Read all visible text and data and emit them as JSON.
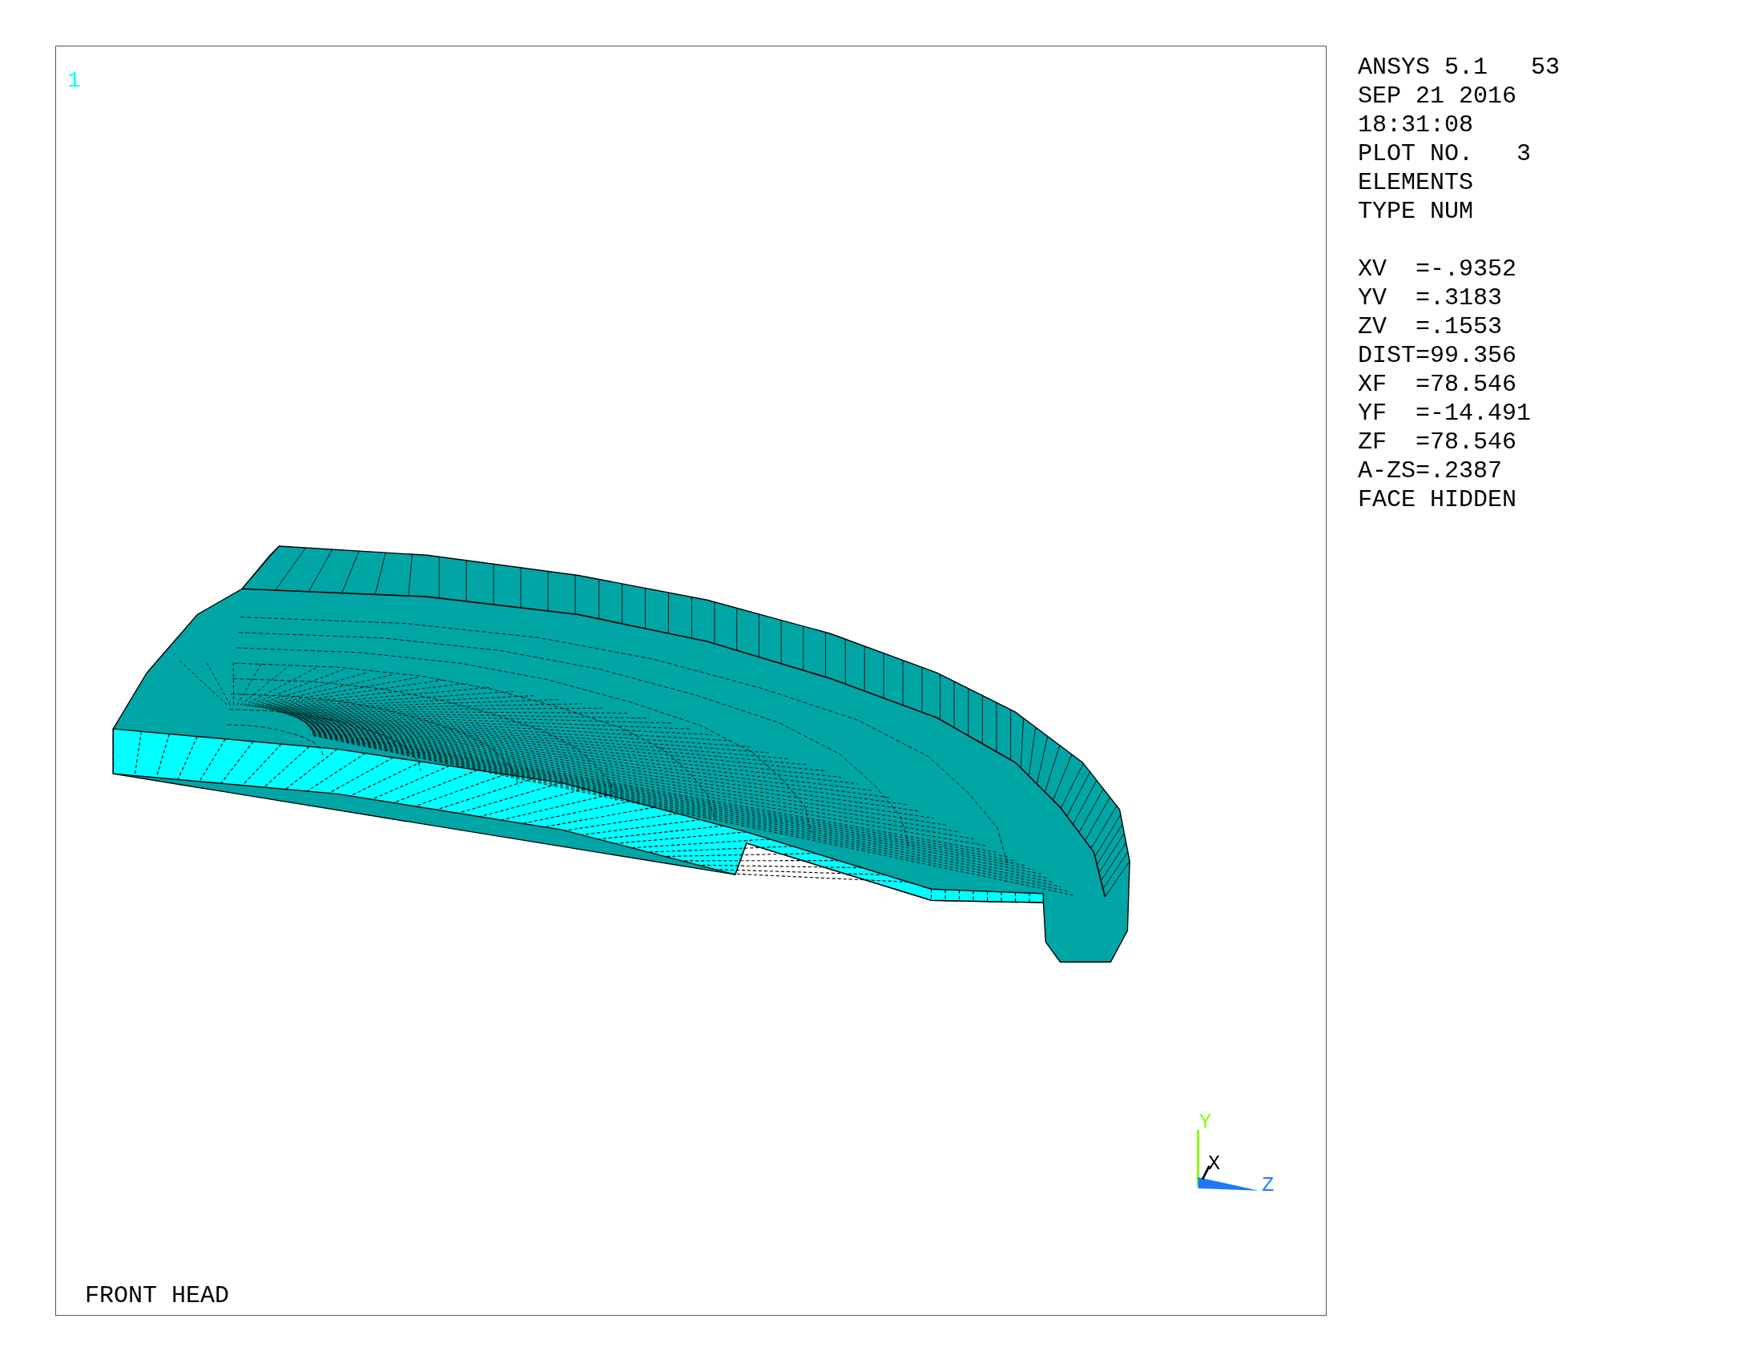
{
  "plot": {
    "window_number": "1",
    "title": "FRONT HEAD",
    "triad": {
      "y_label": "Y",
      "x_label": "X",
      "z_label": "Z"
    }
  },
  "legend": {
    "header": [
      "ANSYS 5.1   53",
      "SEP 21 2016",
      "18:31:08",
      "PLOT NO.   3",
      "ELEMENTS",
      "TYPE NUM"
    ],
    "view": [
      "XV  =-.9352",
      "YV  =.3183",
      "ZV  =.1553",
      "DIST=99.356",
      "XF  =78.546",
      "YF  =-14.491",
      "ZF  =78.546",
      "A-ZS=.2387",
      "FACE HIDDEN"
    ]
  }
}
